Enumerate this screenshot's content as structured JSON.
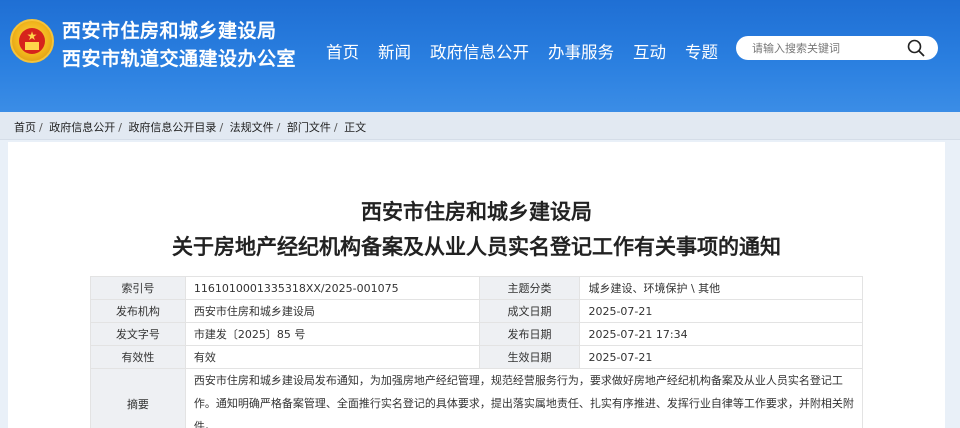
{
  "header": {
    "title_line1": "西安市住房和城乡建设局",
    "title_line2": "西安市轨道交通建设办公室"
  },
  "nav": {
    "items": [
      "首页",
      "新闻",
      "政府信息公开",
      "办事服务",
      "互动",
      "专题"
    ]
  },
  "search": {
    "placeholder": "请输入搜索关键词"
  },
  "breadcrumb": {
    "items": [
      "首页",
      "政府信息公开",
      "政府信息公开目录",
      "法规文件",
      "部门文件",
      "正文"
    ]
  },
  "article": {
    "title_line1": "西安市住房和城乡建设局",
    "title_line2": "关于房地产经纪机构备案及从业人员实名登记工作有关事项的通知"
  },
  "meta": {
    "index_label": "索引号",
    "index_value": "1161010001335318XX/2025-001075",
    "topic_label": "主题分类",
    "topic_value": "城乡建设、环境保护 \\ 其他",
    "publisher_label": "发布机构",
    "publisher_value": "西安市住房和城乡建设局",
    "created_label": "成文日期",
    "created_value": "2025-07-21",
    "docno_label": "发文字号",
    "docno_value": "市建发〔2025〕85 号",
    "published_label": "发布日期",
    "published_value": "2025-07-21 17:34",
    "validity_label": "有效性",
    "validity_value": "有效",
    "effective_label": "生效日期",
    "effective_value": "2025-07-21",
    "abstract_label": "摘要",
    "abstract_value": "西安市住房和城乡建设局发布通知，为加强房地产经纪管理，规范经营服务行为，要求做好房地产经纪机构备案及从业人员实名登记工作。通知明确严格备案管理、全面推行实名登记的具体要求，提出落实属地责任、扎实有序推进、发挥行业自律等工作要求，并附相关附件。"
  },
  "colors": {
    "header_blue": "#2a7fe0",
    "label_bg": "#eef0f3"
  }
}
